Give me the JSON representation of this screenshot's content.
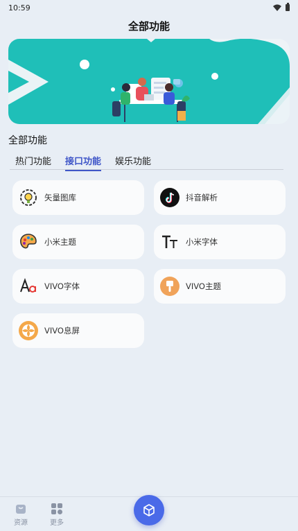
{
  "status_bar": {
    "time": "10:59"
  },
  "header": {
    "title": "全部功能"
  },
  "section": {
    "title": "全部功能"
  },
  "tabs": [
    {
      "label": "热门功能",
      "active": false
    },
    {
      "label": "接口功能",
      "active": true
    },
    {
      "label": "娱乐功能",
      "active": false
    }
  ],
  "features": [
    {
      "label": "矢量图库",
      "icon": "gear-bulb-icon"
    },
    {
      "label": "抖音解析",
      "icon": "tiktok-icon"
    },
    {
      "label": "小米主题",
      "icon": "palette-icon"
    },
    {
      "label": "小米字体",
      "icon": "text-tt-icon"
    },
    {
      "label": "VIVO字体",
      "icon": "font-aa-icon"
    },
    {
      "label": "VIVO主题",
      "icon": "brush-icon"
    },
    {
      "label": "VIVO息屏",
      "icon": "aperture-icon"
    }
  ],
  "bottom_nav": {
    "items": [
      {
        "label": "资源",
        "icon": "bag-icon"
      },
      {
        "label": "更多",
        "icon": "grid-icon"
      }
    ],
    "center_icon": "cube-icon"
  },
  "colors": {
    "accent": "#3f56c8",
    "banner_teal": "#1fbfb8",
    "fab": "#4a6ae8"
  }
}
